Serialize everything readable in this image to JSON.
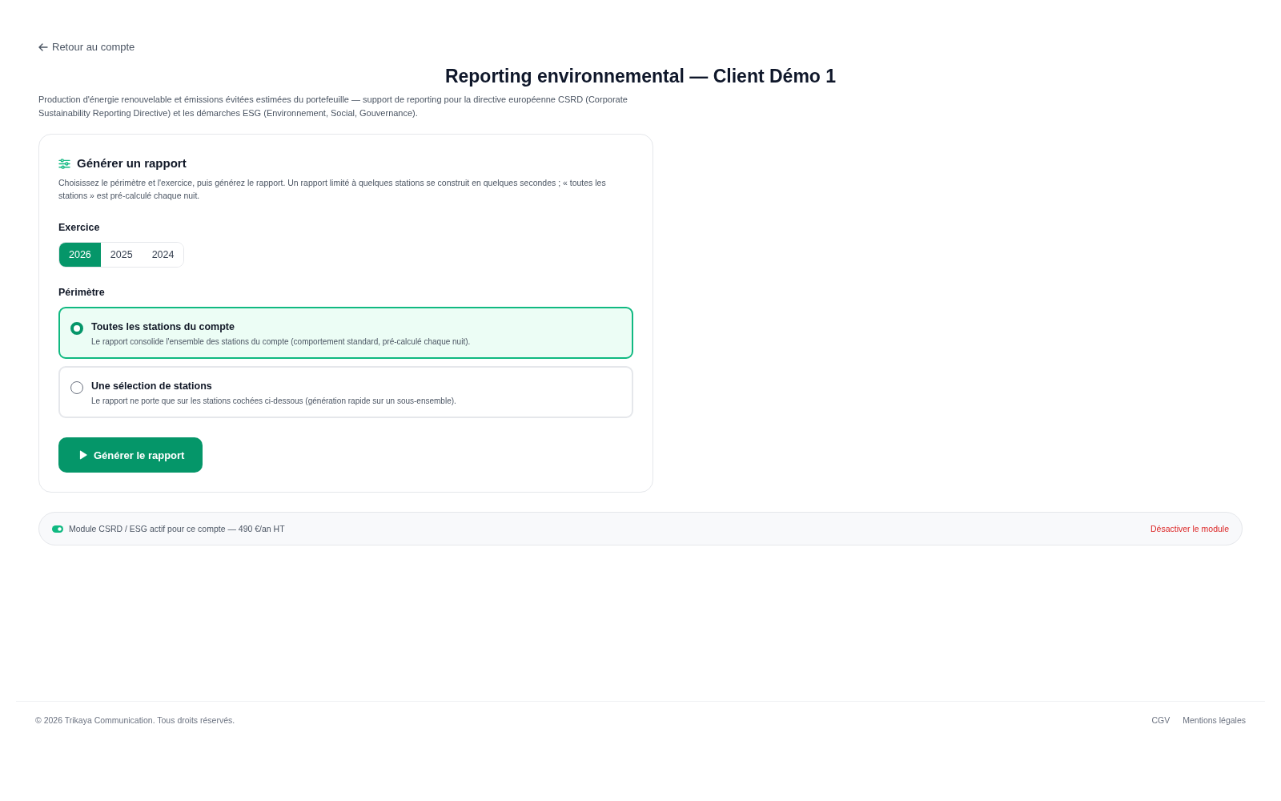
{
  "back_link": {
    "label": "Retour au compte"
  },
  "title": "Reporting environnemental — Client Démo 1",
  "subtitle": "Production d'énergie renouvelable et émissions évitées estimées du portefeuille — support de reporting pour la directive européenne CSRD (Corporate Sustainability Reporting Directive) et les démarches ESG (Environnement, Social, Gouvernance).",
  "report_card": {
    "title": "Générer un rapport",
    "description": "Choisissez le périmètre et l'exercice, puis générez le rapport. Un rapport limité à quelques stations se construit en quelques secondes ; « toutes les stations » est pré-calculé chaque nuit.",
    "fiscal_year": {
      "label": "Exercice",
      "options": [
        {
          "label": "2026",
          "selected": true
        },
        {
          "label": "2025",
          "selected": false
        },
        {
          "label": "2024",
          "selected": false
        }
      ]
    },
    "scope": {
      "label": "Périmètre",
      "options": [
        {
          "title": "Toutes les stations du compte",
          "description": "Le rapport consolide l'ensemble des stations du compte (comportement standard, pré-calculé chaque nuit).",
          "selected": true
        },
        {
          "title": "Une sélection de stations",
          "description": "Le rapport ne porte que sur les stations cochées ci-dessous (génération rapide sur un sous-ensemble).",
          "selected": false
        }
      ]
    },
    "generate_button": {
      "label": "Générer le rapport"
    }
  },
  "module_bar": {
    "active": true,
    "text": "Module CSRD / ESG actif pour ce compte — 490 €/an HT",
    "deactivate_link": "Désactiver le module"
  },
  "footer": {
    "copyright": "© 2026 Trikaya Communication. Tous droits réservés.",
    "links": [
      "CGV",
      "Mentions légales"
    ]
  }
}
